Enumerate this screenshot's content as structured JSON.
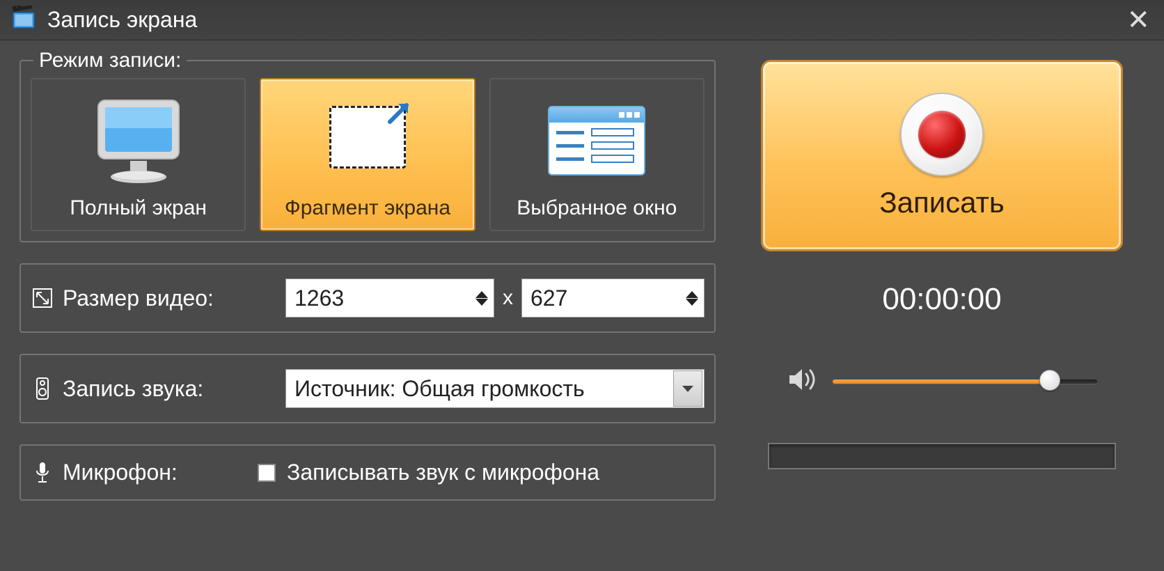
{
  "titlebar": {
    "title": "Запись экрана"
  },
  "recording_mode": {
    "legend": "Режим записи:",
    "full_screen": "Полный экран",
    "fragment": "Фрагмент экрана",
    "window": "Выбранное окно"
  },
  "video_size": {
    "label": "Размер видео:",
    "width": "1263",
    "height": "627",
    "separator": "x"
  },
  "audio": {
    "label": "Запись звука:",
    "source": "Источник: Общая громкость"
  },
  "microphone": {
    "label": "Микрофон:",
    "checkbox_label": "Записывать звук с микрофона"
  },
  "record": {
    "button": "Записать",
    "timer": "00:00:00",
    "volume_percent": 82
  }
}
